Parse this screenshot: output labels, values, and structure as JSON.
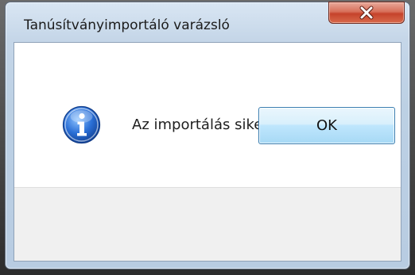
{
  "dialog": {
    "title": "Tanúsítványimportáló varázsló",
    "message": "Az importálás sikeres volt.",
    "ok_label": "OK"
  },
  "icons": {
    "close": "close-icon",
    "info": "info-icon"
  },
  "colors": {
    "close_button": "#c9452c",
    "info_icon": "#2a6fd6",
    "ok_button_border": "#3c7fb1"
  }
}
